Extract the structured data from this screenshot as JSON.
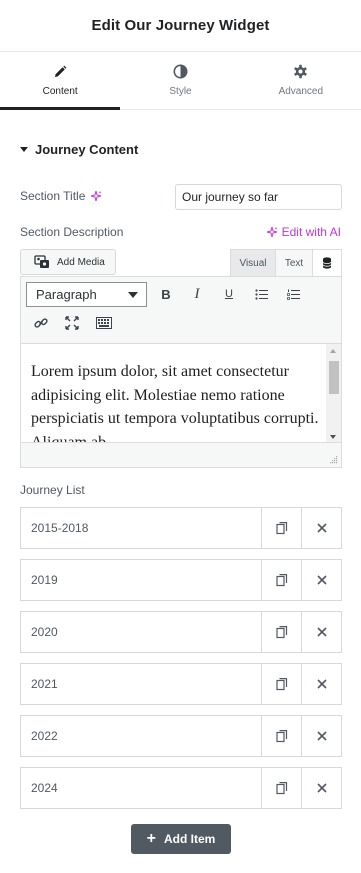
{
  "header": {
    "title": "Edit Our Journey Widget"
  },
  "tabs": [
    {
      "label": "Content",
      "icon": "pencil-icon",
      "active": true
    },
    {
      "label": "Style",
      "icon": "contrast-icon",
      "active": false
    },
    {
      "label": "Advanced",
      "icon": "gear-icon",
      "active": false
    }
  ],
  "section": {
    "title": "Journey Content"
  },
  "fields": {
    "section_title_label": "Section Title",
    "section_title_value": "Our journey so far",
    "section_description_label": "Section Description",
    "edit_with_ai": "Edit with AI"
  },
  "editor": {
    "add_media": "Add Media",
    "mode_visual": "Visual",
    "mode_text": "Text",
    "format_value": "Paragraph",
    "content": "Lorem ipsum dolor, sit amet consectetur adipisicing elit. Molestiae nemo ratione perspiciatis ut tempora voluptatibus corrupti. Aliquam ab"
  },
  "journey_list": {
    "label": "Journey List",
    "items": [
      "2015-2018",
      "2019",
      "2020",
      "2021",
      "2022",
      "2024"
    ],
    "add_label": "Add Item"
  },
  "colors": {
    "accent_ai": "#c036d8",
    "primary_text": "#1f2124",
    "secondary_text": "#515962",
    "add_button_bg": "#515962"
  }
}
